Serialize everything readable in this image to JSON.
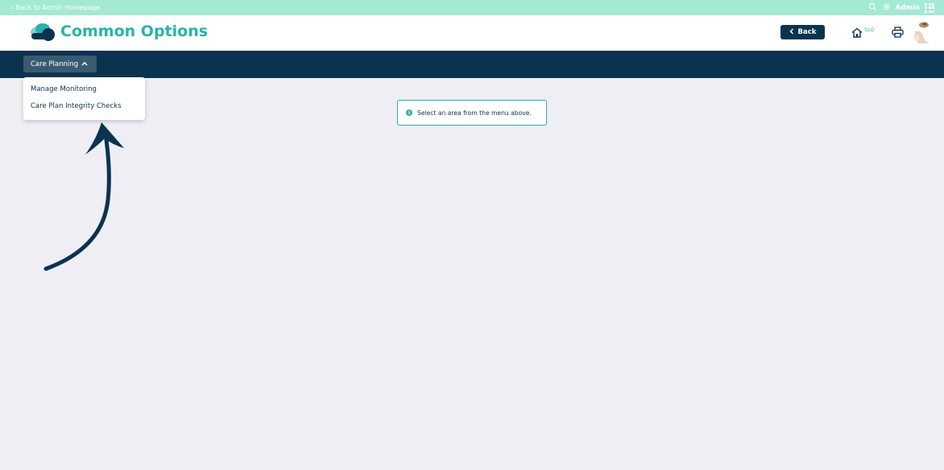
{
  "topbar": {
    "back_link": "‹ Back to Admin Homepage",
    "user_label": "Admin",
    "search_icon": "search-icon",
    "settings_icon": "gear-icon",
    "apps_icon": "grid-icon"
  },
  "header": {
    "title": "Common Options",
    "back_button": "Back",
    "home_label": "SLO"
  },
  "nav": {
    "menu_label": "Care Planning",
    "dropdown_items": [
      "Manage Monitoring",
      "Care Plan Integrity Checks"
    ]
  },
  "main": {
    "info_message": "Select an area from the menu above."
  },
  "colors": {
    "topbar": "#a4e9d3",
    "brand_teal": "#27b3ae",
    "navy": "#0b3350",
    "background": "#efeef4"
  }
}
